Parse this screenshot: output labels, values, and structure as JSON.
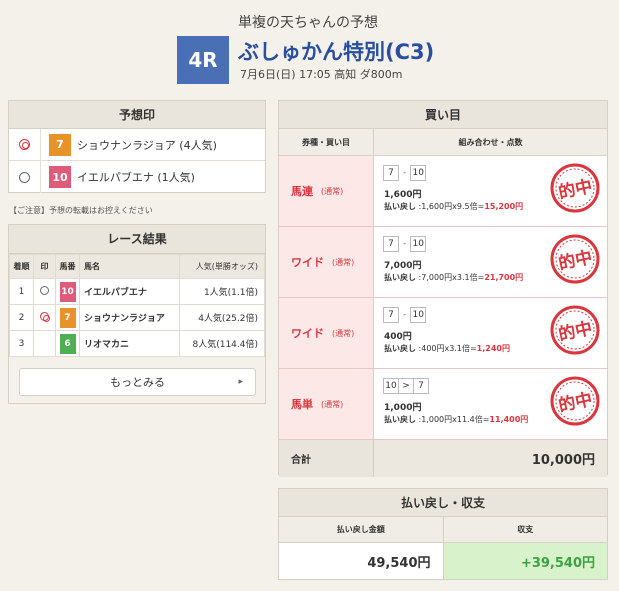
{
  "header": {
    "subtitle": "単複の天ちゃんの予想",
    "race_number": "4R",
    "race_title": "ぶしゅかん特別(C3)",
    "race_meta": "7月6日(日) 17:05 高知 ダ800m"
  },
  "yoso": {
    "title": "予想印",
    "items": [
      {
        "mark": "double-circle",
        "num": "7",
        "color": "#e8922a",
        "text": "ショウナンラジョア (4人気)"
      },
      {
        "mark": "circle",
        "num": "10",
        "color": "#e05a7a",
        "text": "イエルパブエナ (1人気)"
      }
    ],
    "caution": "【ご注意】予想の転載はお控えください"
  },
  "result": {
    "title": "レース結果",
    "headers": [
      "着順",
      "印",
      "馬番",
      "馬名",
      "人気(単勝オッズ)"
    ],
    "rows": [
      {
        "rank": "1",
        "mark": "circle",
        "num": "10",
        "color": "#e05a7a",
        "name": "イエルパブエナ",
        "pop": "1人気(1.1倍)"
      },
      {
        "rank": "2",
        "mark": "double-circle",
        "num": "7",
        "color": "#e8922a",
        "name": "ショウナンラジョア",
        "pop": "4人気(25.2倍)"
      },
      {
        "rank": "3",
        "mark": "",
        "num": "6",
        "color": "#4caf50",
        "name": "リオマカニ",
        "pop": "8人気(114.4倍)"
      }
    ],
    "more_label": "もっとみる"
  },
  "kaime": {
    "title": "買い目",
    "col1": "券種・買い目",
    "col2": "組み合わせ・点数",
    "bets": [
      {
        "type": "馬連",
        "sub": "(通常)",
        "a": "7",
        "sep": "-",
        "b": "10",
        "amount": "1,600円",
        "pay_label": "払い戻し",
        "pay_calc": ":1,600円x9.5倍=",
        "pay_result": "15,200円",
        "stamp": "的中"
      },
      {
        "type": "ワイド",
        "sub": "(通常)",
        "a": "7",
        "sep": "-",
        "b": "10",
        "amount": "7,000円",
        "pay_label": "払い戻し",
        "pay_calc": ":7,000円x3.1倍=",
        "pay_result": "21,700円",
        "stamp": "的中"
      },
      {
        "type": "ワイド",
        "sub": "(通常)",
        "a": "7",
        "sep": "-",
        "b": "10",
        "amount": "400円",
        "pay_label": "払い戻し",
        "pay_calc": ":400円x3.1倍=",
        "pay_result": "1,240円",
        "stamp": "的中"
      },
      {
        "type": "馬単",
        "sub": "(通常)",
        "a": "10",
        "sep": ">",
        "b": "7",
        "amount": "1,000円",
        "pay_label": "払い戻し",
        "pay_calc": ":1,000円x11.4倍=",
        "pay_result": "11,400円",
        "stamp": "的中"
      }
    ],
    "total_label": "合計",
    "total_value": "10,000円"
  },
  "shushi": {
    "title": "払い戻し・収支",
    "col1": "払い戻し金額",
    "col2": "収支",
    "payout": "49,540円",
    "balance": "+39,540円"
  }
}
